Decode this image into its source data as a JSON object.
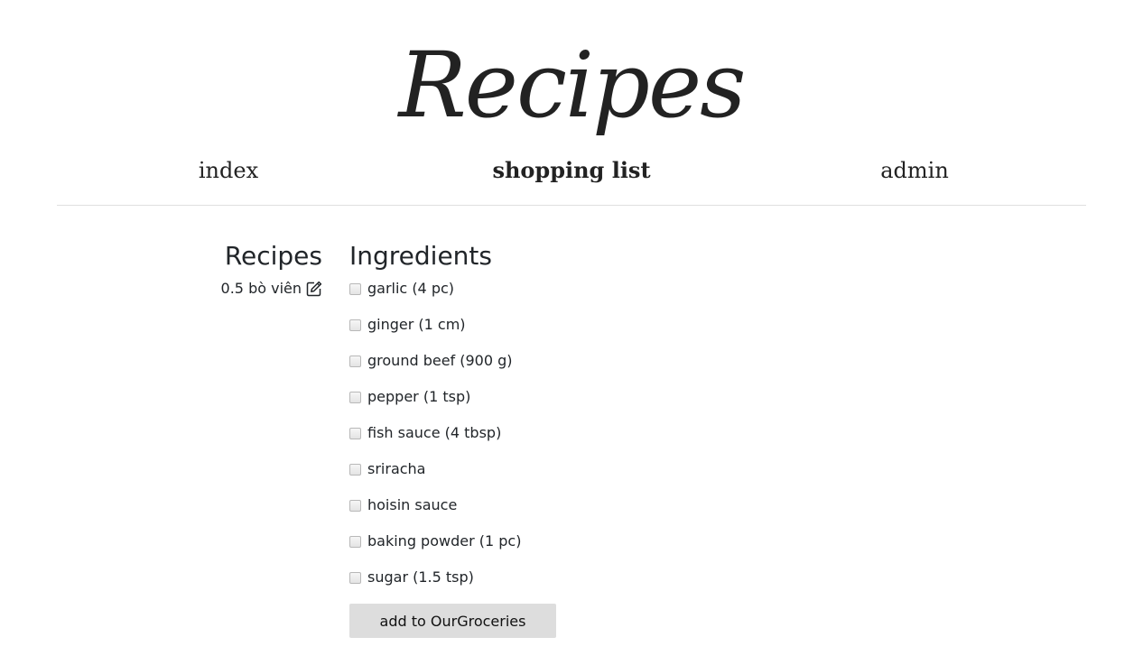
{
  "header": {
    "site_title": "Recipes"
  },
  "nav": {
    "items": [
      {
        "label": "index",
        "active": false
      },
      {
        "label": "shopping list",
        "active": true
      },
      {
        "label": "admin",
        "active": false
      }
    ]
  },
  "recipes": {
    "heading": "Recipes",
    "items": [
      {
        "label": "0.5 bò viên",
        "icon": "edit-icon"
      }
    ]
  },
  "ingredients": {
    "heading": "Ingredients",
    "items": [
      {
        "label": "garlic (4 pc)",
        "checked": false
      },
      {
        "label": "ginger (1 cm)",
        "checked": false
      },
      {
        "label": "ground beef (900 g)",
        "checked": false
      },
      {
        "label": "pepper (1 tsp)",
        "checked": false
      },
      {
        "label": "fish sauce (4 tbsp)",
        "checked": false
      },
      {
        "label": "sriracha",
        "checked": false
      },
      {
        "label": "hoisin sauce",
        "checked": false
      },
      {
        "label": "baking powder (1 pc)",
        "checked": false
      },
      {
        "label": "sugar (1.5 tsp)",
        "checked": false
      }
    ],
    "button_label": "add to OurGroceries"
  }
}
